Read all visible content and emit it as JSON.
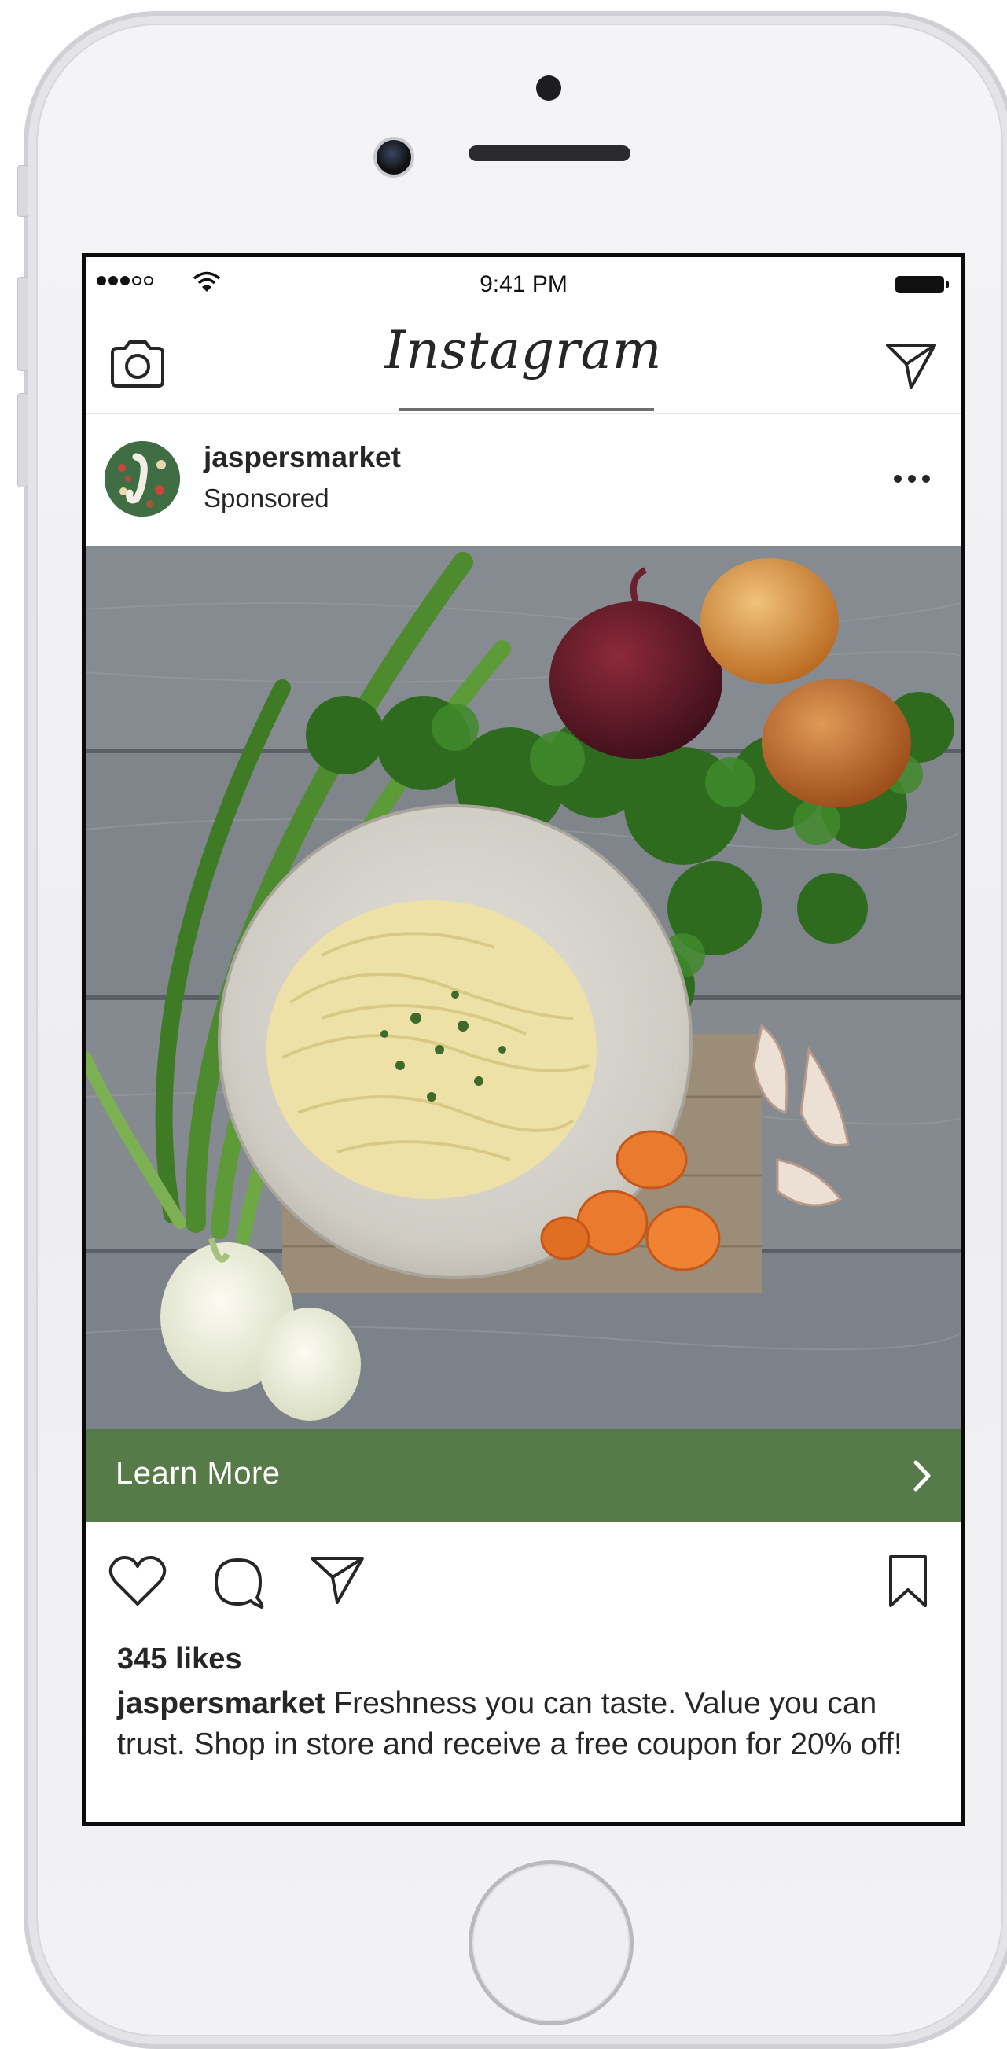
{
  "status_bar": {
    "time": "9:41 PM",
    "signal_dots_filled": 3,
    "signal_dots_total": 5
  },
  "nav": {
    "app_title": "Instagram",
    "left_icon": "camera-icon",
    "right_icon": "direct-message-icon"
  },
  "post": {
    "username": "jaspersmarket",
    "label": "Sponsored",
    "more_icon": "ellipsis-icon",
    "cta_label": "Learn More",
    "likes": "345 likes",
    "caption_user": "jaspersmarket",
    "caption_text": "Freshness you can taste. Value you can trust. Shop in store and receive a free coupon for 20% off!"
  },
  "colors": {
    "cta_background": "#567b48",
    "text": "#262626",
    "cta_text": "#ffffff"
  }
}
